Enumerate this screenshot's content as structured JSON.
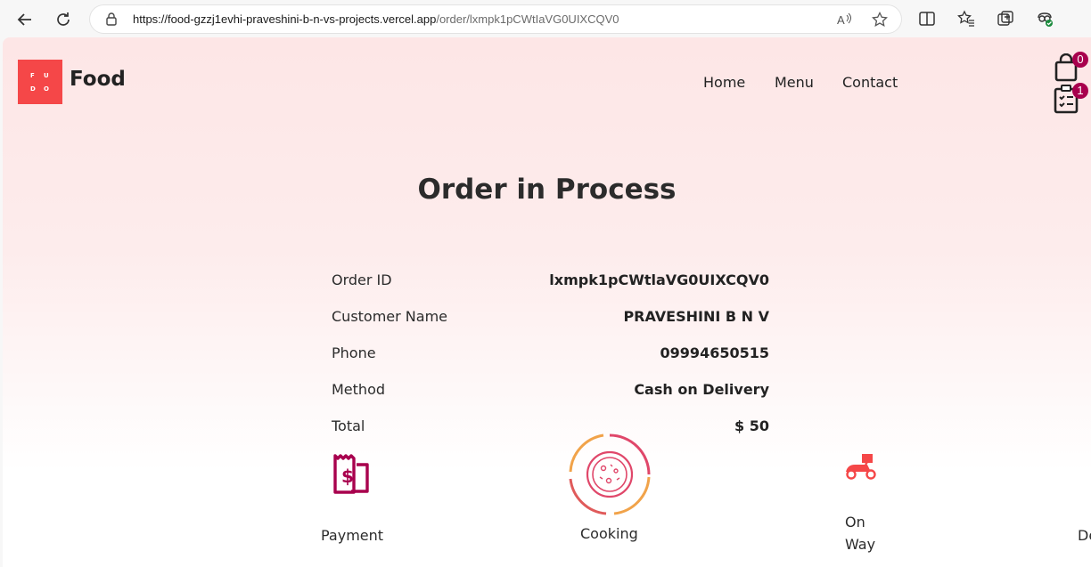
{
  "browser": {
    "url_host": "https://food-gzzj1evhi-praveshini-b-n-vs-projects.vercel.app",
    "url_path": "/order/lxmpk1pCWtIaVG0UIXCQV0",
    "icons": [
      "back-icon",
      "refresh-icon",
      "lock-icon",
      "read-aloud-icon",
      "favorite-star-icon",
      "split-screen-icon",
      "favorites-icon",
      "collections-icon",
      "extensions-icon"
    ]
  },
  "header": {
    "logo_letters": [
      "F",
      "U",
      "D",
      "O"
    ],
    "brand": "Food",
    "nav": [
      "Home",
      "Menu",
      "Contact"
    ],
    "cart_count": "0",
    "orders_count": "1"
  },
  "order": {
    "title": "Order in Process",
    "rows": [
      {
        "label": "Order ID",
        "value": "lxmpk1pCWtlaVG0UIXCQV0"
      },
      {
        "label": "Customer Name",
        "value": "PRAVESHINI B N V"
      },
      {
        "label": "Phone",
        "value": "09994650515"
      },
      {
        "label": "Method",
        "value": "Cash on Delivery"
      },
      {
        "label": "Total",
        "value": "$ 50"
      }
    ]
  },
  "steps": [
    {
      "label": "Payment",
      "icon": "bill-dollar-icon"
    },
    {
      "label": "Cooking",
      "icon": "pizza-icon"
    },
    {
      "label_line1": "On",
      "label_line2": "Way",
      "icon": "scooter-icon"
    },
    {
      "label": "De",
      "icon": "delivered-icon"
    }
  ],
  "colors": {
    "accent_red": "#f54748",
    "payment_icon": "#a8004d",
    "badge": "#a8004d"
  }
}
